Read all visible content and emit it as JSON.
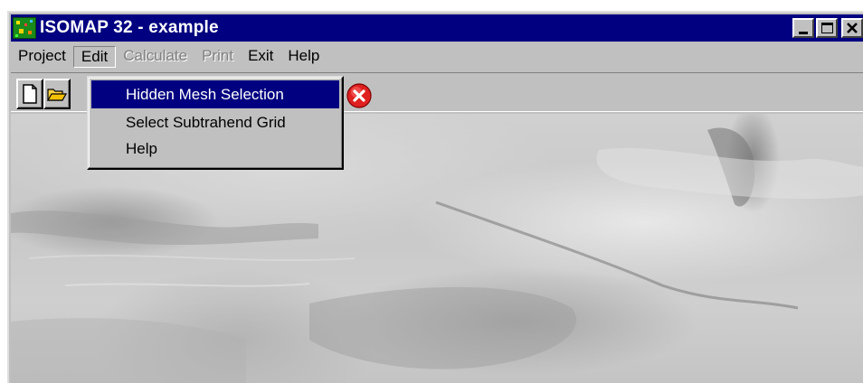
{
  "window": {
    "title": "ISOMAP 32 - example",
    "controls": {
      "minimize": "_",
      "maximize": "□",
      "close": "×"
    }
  },
  "menubar": {
    "items": [
      {
        "label": "Project",
        "enabled": true
      },
      {
        "label": "Edit",
        "enabled": true,
        "open": true
      },
      {
        "label": "Calculate",
        "enabled": false
      },
      {
        "label": "Print",
        "enabled": false
      },
      {
        "label": "Exit",
        "enabled": true
      },
      {
        "label": "Help",
        "enabled": true
      }
    ]
  },
  "toolbar": {
    "buttons": [
      {
        "icon": "new-document-icon"
      },
      {
        "icon": "open-folder-icon"
      },
      {
        "icon": "close-red-icon"
      }
    ]
  },
  "edit_menu": {
    "items": [
      {
        "label": "Hidden Mesh Selection",
        "selected": true
      },
      {
        "label": "Select Subtrahend Grid",
        "selected": false
      },
      {
        "label": "Help",
        "selected": false
      }
    ]
  },
  "colors": {
    "titlebar": "#000080",
    "face": "#c0c0c0",
    "highlight": "#000080",
    "disabled_text": "#808080",
    "close_icon": "#e02020"
  }
}
